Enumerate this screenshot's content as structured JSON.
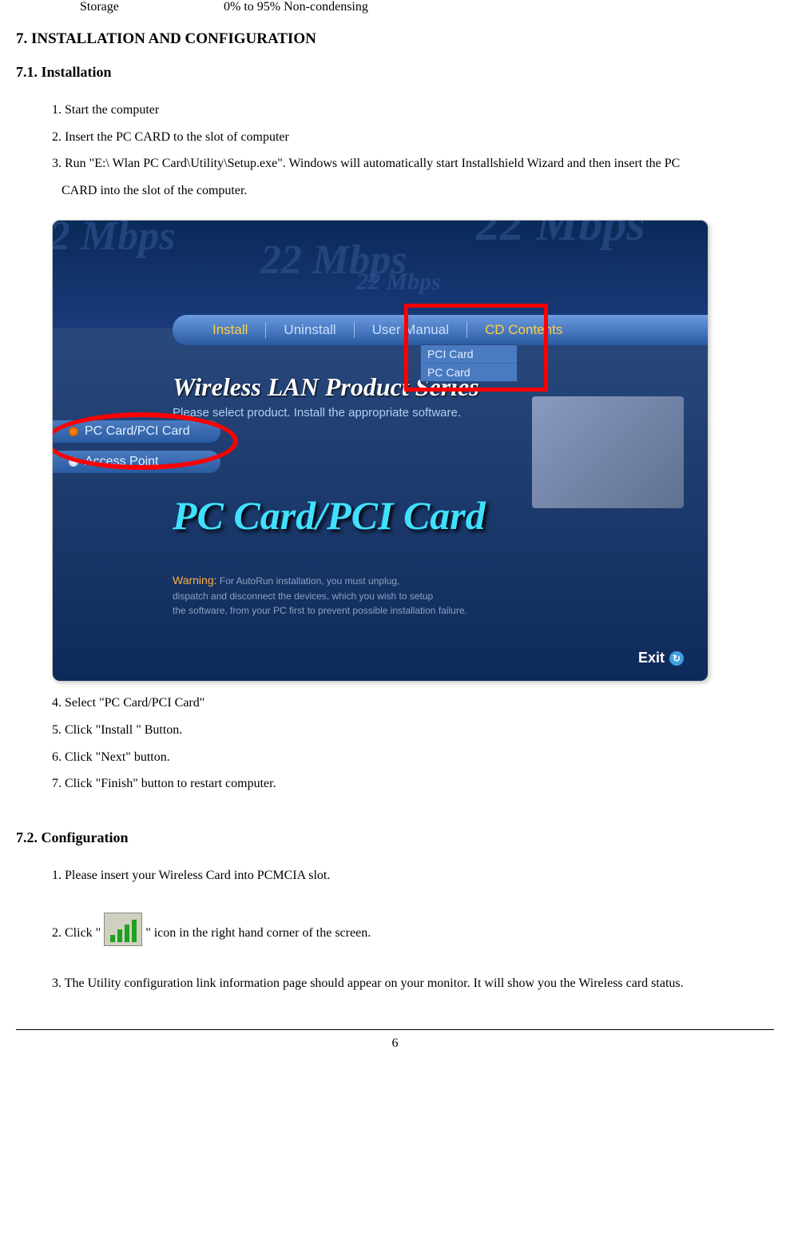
{
  "spec": {
    "label": "Storage",
    "value": "0% to 95% Non-condensing"
  },
  "heading_main": "7. INSTALLATION AND CONFIGURATION",
  "section_71": {
    "title": "7.1. Installation",
    "steps": {
      "s1": "1. Start the computer",
      "s2": "2. Insert the PC CARD to the slot of computer",
      "s3": "3. Run \"E:\\ Wlan PC Card\\Utility\\Setup.exe\". Windows will automatically start Installshield Wizard and then insert the PC",
      "s3b": "CARD into the slot of the computer.",
      "s4": "4. Select \"PC Card/PCI Card\"",
      "s5": "5. Click \"Install \" Button.",
      "s6": "6. Click \"Next\" button.",
      "s7": "7. Click \"Finish\" button to restart computer."
    }
  },
  "installer": {
    "mbps": "22 Mbps",
    "nav": {
      "install": "Install",
      "uninstall": "Uninstall",
      "manual": "User Manual",
      "cd": "CD Contents"
    },
    "dropdown": {
      "pci": "PCI Card",
      "pc": "PC Card"
    },
    "wlan_title": "Wireless LAN Product Series",
    "wlan_sub": "Please select product. Install the appropriate software.",
    "side": {
      "opt1": "PC Card/PCI Card",
      "opt2": "Access Point"
    },
    "big_title": "PC Card/PCI Card",
    "warning": {
      "label": "Warning:",
      "line1": "For AutoRun installation, you must unplug,",
      "line2": "dispatch and disconnect the devices, which you wish to setup",
      "line3": "the software, from your PC first to prevent possible installation failure."
    },
    "exit": "Exit"
  },
  "section_72": {
    "title": "7.2. Configuration",
    "step1": "1. Please insert your Wireless Card into PCMCIA slot.",
    "step2a": "2. Click \"",
    "step2b": "\" icon in the right hand corner of the screen.",
    "step3": "3. The Utility configuration link information page should appear on your monitor. It will show you the Wireless card status."
  },
  "page_number": "6"
}
